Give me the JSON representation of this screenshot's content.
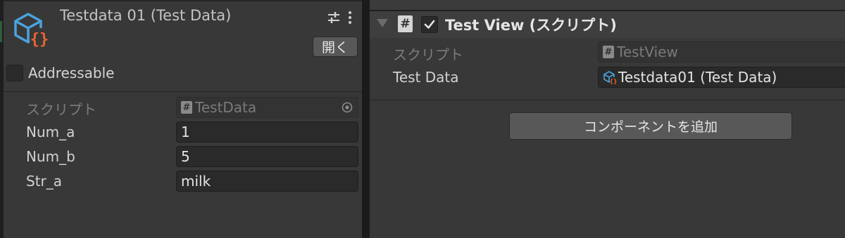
{
  "left": {
    "asset_title": "Testdata 01 (Test Data)",
    "open_button": "開く",
    "addressable_label": "Addressable",
    "properties": [
      {
        "label": "スクリプト",
        "value": "TestData"
      },
      {
        "label": "Num_a",
        "value": "1"
      },
      {
        "label": "Num_b",
        "value": "5"
      },
      {
        "label": "Str_a",
        "value": "milk"
      }
    ]
  },
  "right": {
    "component_title": "Test View (スクリプト)",
    "properties": [
      {
        "label": "スクリプト",
        "value": "TestView"
      },
      {
        "label": "Test Data",
        "value": "Testdata01 (Test Data)"
      }
    ],
    "add_component_button": "コンポーネントを追加"
  },
  "colors": {
    "panel_bg": "#383838",
    "field_bg": "#2a2a2a",
    "button_bg": "#585858",
    "scriptable_icon_blue": "#4aa3df",
    "scriptable_icon_orange": "#e8652f"
  }
}
